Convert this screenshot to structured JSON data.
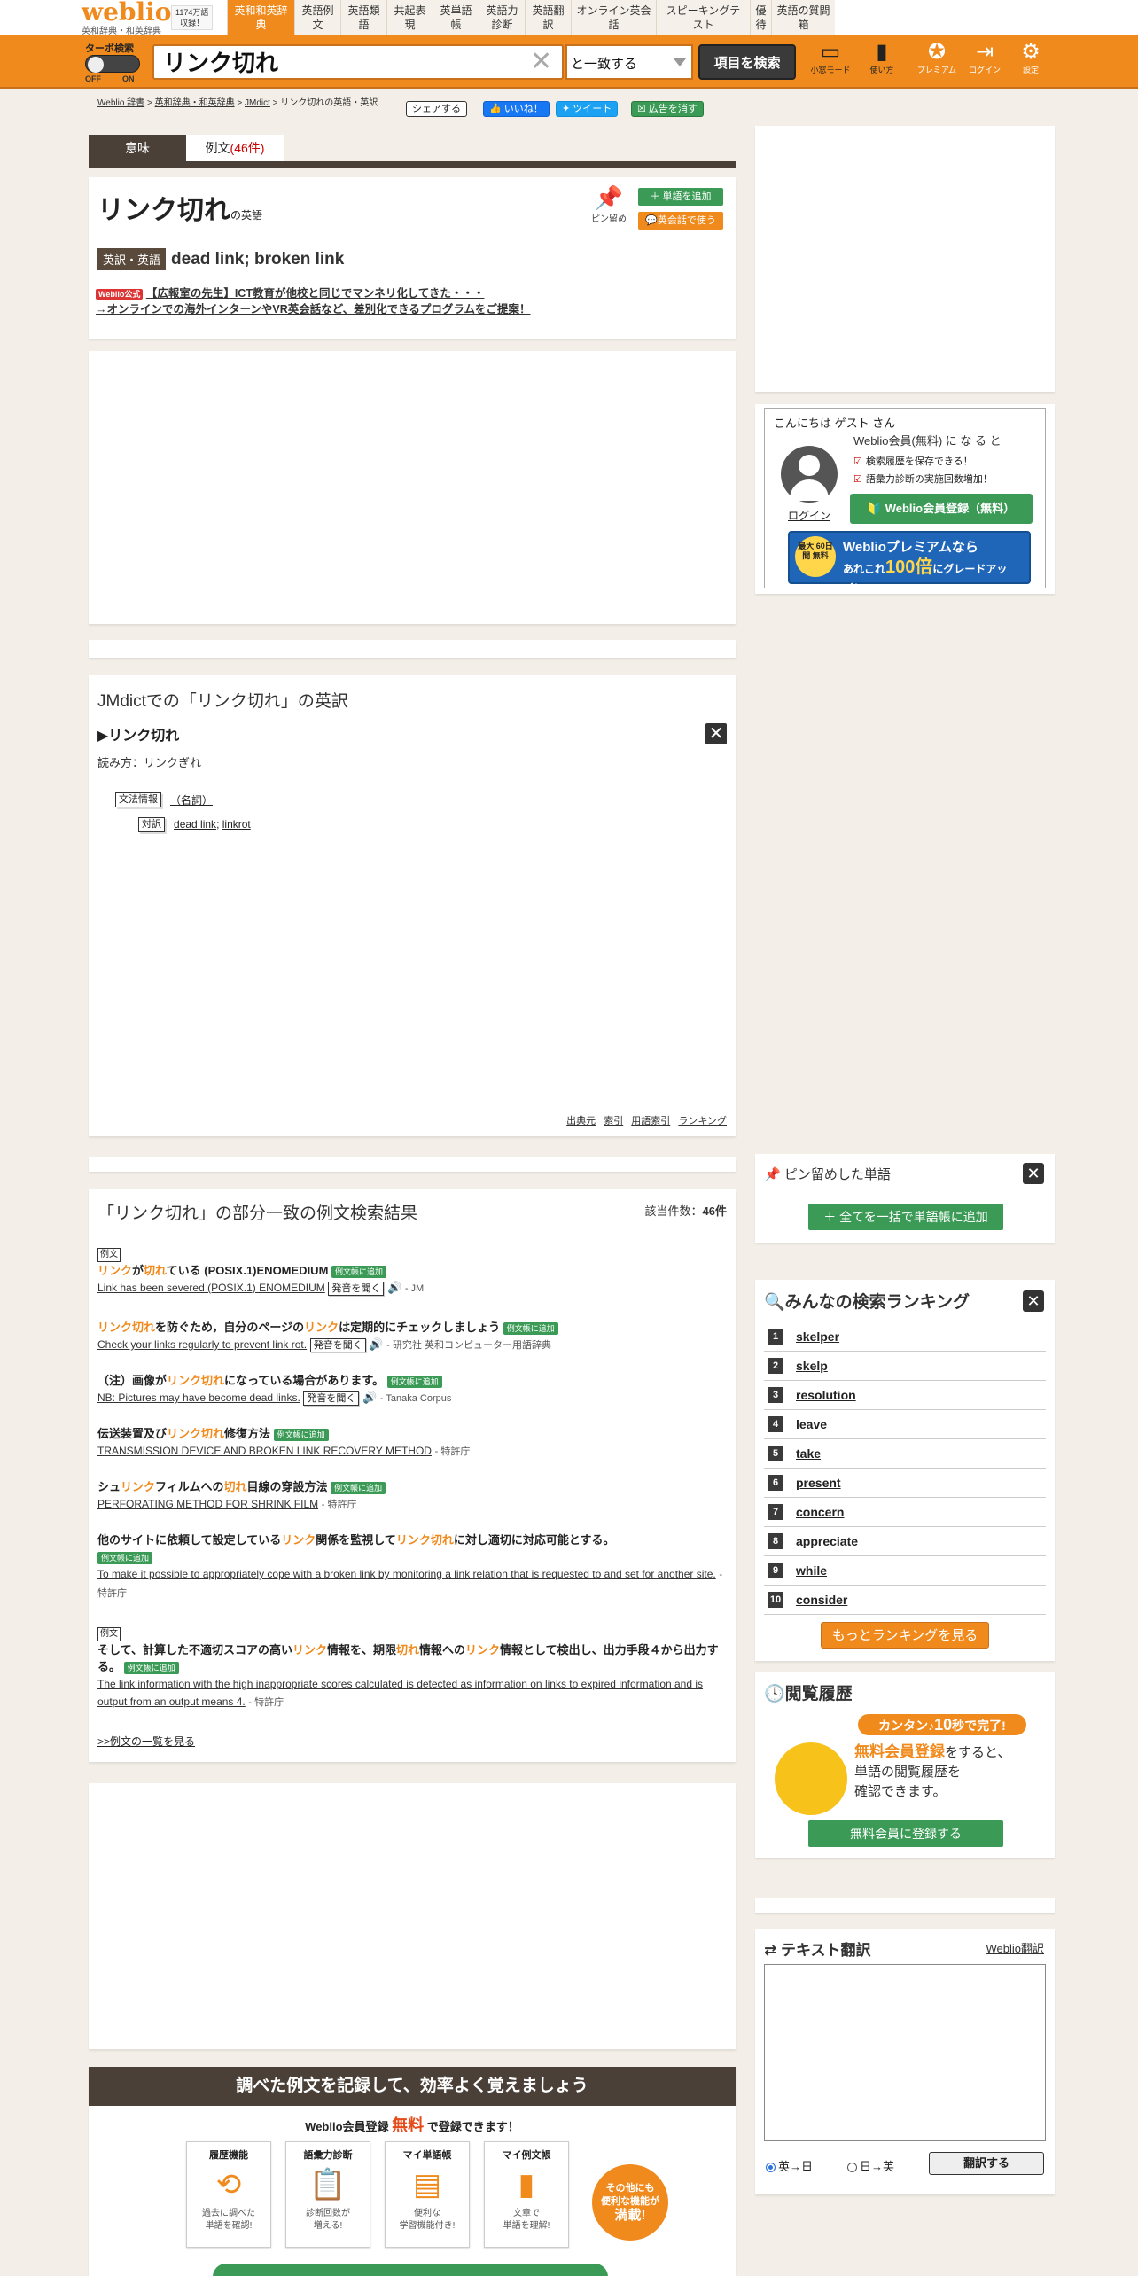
{
  "header": {
    "logo": "weblio",
    "logo_sub": "英和辞典・和英辞典",
    "word_count": "1174万語",
    "word_count_sub": "収録！",
    "nav_tabs": [
      "英和和英辞典",
      "英語例文",
      "英語類語",
      "共起表現",
      "英単語帳",
      "英語力診断",
      "英語翻訳",
      "オンライン英会話",
      "スピーキングテスト",
      "優待",
      "英語の質問箱"
    ]
  },
  "search": {
    "turbo_label": "ターボ検索",
    "toggle_off": "OFF",
    "toggle_on": "ON",
    "query": "リンク切れ",
    "match_mode": "と一致する",
    "search_button": "項目を検索",
    "icons": [
      "小窓モード",
      "使い方",
      "プレミアム",
      "ログイン",
      "設定"
    ]
  },
  "breadcrumb": [
    "Weblio 辞書",
    "英和辞典・和英辞典",
    "JMdict",
    "リンク切れの英語・英訳"
  ],
  "share": {
    "share": "シェアする",
    "like": "いいね！",
    "tweet": "ツイート",
    "remove_ads": "広告を消す"
  },
  "tabs": {
    "meaning": "意味",
    "examples": "例文",
    "examples_count": "(46件)"
  },
  "entry": {
    "headword": "リンク切れ",
    "headword_suffix": "の英語",
    "pin_label": "ピン留め",
    "add_word": "単語を追加",
    "eikaiwa": "英会話で使う",
    "eiyaku_label": "英訳・英語",
    "eiyaku_value": "dead link; broken link",
    "promo_badge": "Weblio公式",
    "promo_line1": "【広報室の先生】ICT教育が他校と同じでマンネリ化してきた・・・",
    "promo_line2": "→オンラインでの海外インターンやVR英会話など、差別化できるプログラムをご提案！"
  },
  "jmdict": {
    "title": "JMdictでの「リンク切れ」の英訳",
    "headword": "▶リンク切れ",
    "yomi_label": "読み方：",
    "yomi": "リンクぎれ",
    "grammar_label": "文法情報",
    "grammar_value": "（名詞）",
    "taiyaku_label": "対訳",
    "taiyaku_value1": "dead link",
    "taiyaku_value2": "linkrot",
    "footer": [
      "出典元",
      "索引",
      "用語索引",
      "ランキング"
    ]
  },
  "examples": {
    "title": "「リンク切れ」の部分一致の例文検索結果",
    "count_label": "該当件数：",
    "count": "46件",
    "rei_label": "例文",
    "add_label": "例文帳に追加",
    "audio_label": "発音を聞く",
    "items": [
      {
        "jp_pre": "",
        "hl1": "リンク",
        "jp_mid": "が",
        "hl2": "切れ",
        "jp_post": "ている (POSIX.1)ENOMEDIUM",
        "en": "Link has been severed (POSIX.1) ENOMEDIUM",
        "src": "- JM"
      },
      {
        "jp_pre": "",
        "hl1": "リンク切れ",
        "jp_mid": "を防ぐため，自分のページの",
        "hl2": "リンク",
        "jp_post": "は定期的にチェックしましょう",
        "en": "Check your links regularly to prevent link rot.",
        "src": "- 研究社 英和コンピューター用語辞典"
      },
      {
        "jp_pre": "（注）画像が",
        "hl1": "リンク切れ",
        "jp_mid": "になっている場合があります。",
        "hl2": "",
        "jp_post": "",
        "en": "NB: Pictures may have become dead links.",
        "src": "- Tanaka Corpus"
      },
      {
        "jp_pre": "伝送装置及び",
        "hl1": "リンク切れ",
        "jp_mid": "修復方法",
        "hl2": "",
        "jp_post": "",
        "en": "TRANSMISSION DEVICE AND BROKEN LINK RECOVERY METHOD",
        "src": "- 特許庁"
      },
      {
        "jp_pre": "シュ",
        "hl1": "リンク",
        "jp_mid": "フィルムへの",
        "hl2": "切れ",
        "jp_post": "目線の穿設方法",
        "en": "PERFORATING METHOD FOR SHRINK FILM",
        "src": "- 特許庁"
      },
      {
        "jp_pre": "他のサイトに依頼して設定している",
        "hl1": "リンク",
        "jp_mid": "関係を監視して",
        "hl2": "リンク切れ",
        "jp_post": "に対し適切に対応可能とする。",
        "en": "To make it possible to appropriately cope with a broken link by monitoring a link relation that is requested to and set for another site.",
        "src": "- 特許庁"
      },
      {
        "jp_pre": "そして、計算した不適切スコアの高い",
        "hl1": "リンク",
        "jp_mid": "情報を、期限",
        "hl2": "切れ",
        "jp_post": "情報への",
        "hl3": "リンク",
        "jp_end": "情報として検出し、出力手段４から出力する。",
        "en": "The link information with the high inappropriate scores calculated is detected as information on links to expired information and is output from an output means 4.",
        "src": "- 特許庁"
      }
    ],
    "more": ">>例文の一覧を見る"
  },
  "banner": {
    "title": "調べた例文を記録して、効率よく覚えましょう",
    "sub_pre": "Weblio会員登録",
    "sub_free": "無料",
    "sub_post": "で登録できます！",
    "features": [
      {
        "title": "履歴機能",
        "icon": "history-icon",
        "desc1": "過去に調べた",
        "desc2": "単語を確認!"
      },
      {
        "title": "語彙力診断",
        "icon": "clipboard-icon",
        "desc1": "診断回数が",
        "desc2": "増える!"
      },
      {
        "title": "マイ単語帳",
        "icon": "cards-icon",
        "desc1": "便利な",
        "desc2": "学習機能付き!"
      },
      {
        "title": "マイ例文帳",
        "icon": "notebook-icon",
        "desc1": "文章で",
        "desc2": "単語を理解!"
      }
    ],
    "more1": "その他にも",
    "more2": "便利な機能が",
    "more3": "満載!"
  },
  "member": {
    "hello": "こんにちは ゲスト さん",
    "login": "ログイン",
    "title": "Weblio会員(無料) に な る と",
    "benefits": [
      "検索履歴を保存できる！",
      "語彙力診断の実施回数増加！"
    ],
    "register": "Weblio会員登録（無料）",
    "premium_title": "Weblioプレミアムなら",
    "premium_sub_pre": "あれこれ",
    "premium_sub_num": "100倍",
    "premium_sub_post": "にグレードアップ！",
    "premium_circle": "最大 60日間 無料"
  },
  "pinned": {
    "title": "ピン留めした単語",
    "add_all": "全てを一括で単語帳に追加"
  },
  "ranking": {
    "title": "みんなの検索ランキング",
    "items": [
      "skelper",
      "skelp",
      "resolution",
      "leave",
      "take",
      "present",
      "concern",
      "appreciate",
      "while",
      "consider"
    ],
    "more": "もっとランキングを見る"
  },
  "history": {
    "title": "閲覧履歴",
    "pill_pre": "カンタン♪",
    "pill_num": "10",
    "pill_post": "秒で完了!",
    "line1_hl": "無料会員登録",
    "line1": "をすると、",
    "line2": "単語の閲覧履歴を",
    "line3": "確認できます。",
    "button": "無料会員に登録する"
  },
  "translate": {
    "title": "テキスト翻訳",
    "link": "Weblio翻訳",
    "option1": "英→日",
    "option2": "日→英",
    "button": "翻訳する"
  }
}
